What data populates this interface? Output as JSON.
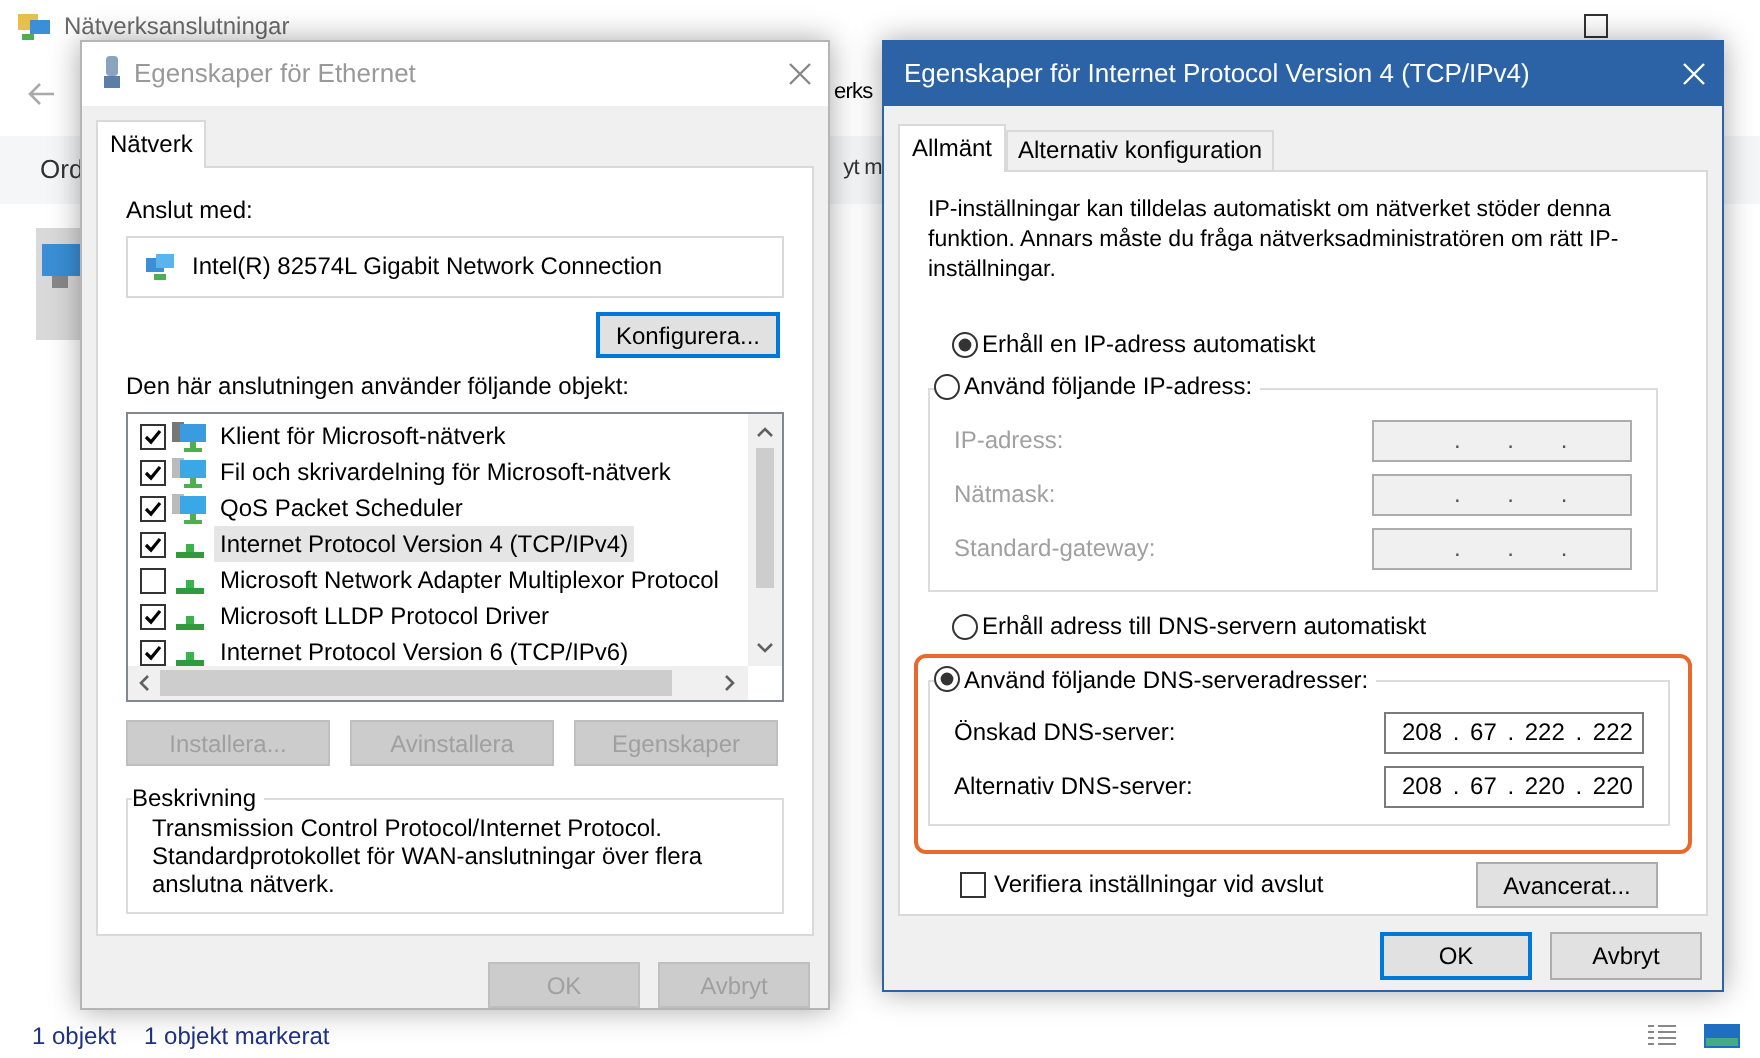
{
  "explorer": {
    "title": "Nätverksanslutningar",
    "address_fragment": "erks",
    "toolbar_left": "Ord",
    "toolbar_right": "yt m",
    "status_bar": [
      "1 objekt",
      "1 objekt markerat"
    ]
  },
  "ethernet_dialog": {
    "title": "Egenskaper för Ethernet",
    "active": false,
    "tabs": [
      {
        "label": "Nätverk",
        "selected": true
      }
    ],
    "connect_label": "Anslut med:",
    "adapter": "Intel(R) 82574L Gigabit Network Connection",
    "configure_button": "Konfigurera...",
    "items_label": "Den här anslutningen använder följande objekt:",
    "items": [
      {
        "label": "Klient för Microsoft-nätverk",
        "kind": "client",
        "checked": true,
        "selected": false
      },
      {
        "label": "Fil och skrivardelning för Microsoft-nätverk",
        "kind": "service",
        "checked": true,
        "selected": false
      },
      {
        "label": "QoS Packet Scheduler",
        "kind": "service",
        "checked": true,
        "selected": false
      },
      {
        "label": "Internet Protocol Version 4 (TCP/IPv4)",
        "kind": "protocol",
        "checked": true,
        "selected": true
      },
      {
        "label": "Microsoft Network Adapter Multiplexor Protocol",
        "kind": "protocol",
        "checked": false,
        "selected": false
      },
      {
        "label": "Microsoft LLDP Protocol Driver",
        "kind": "protocol",
        "checked": true,
        "selected": false
      },
      {
        "label": "Internet Protocol Version 6 (TCP/IPv6)",
        "kind": "protocol",
        "checked": true,
        "selected": false
      }
    ],
    "item_buttons": [
      {
        "label": "Installera...",
        "disabled": true
      },
      {
        "label": "Avinstallera",
        "disabled": true
      },
      {
        "label": "Egenskaper",
        "disabled": true
      }
    ],
    "description": {
      "title": "Beskrivning",
      "text": "Transmission Control Protocol/Internet Protocol. Standardprotokollet för WAN-anslutningar över flera anslutna nätverk."
    },
    "buttons": [
      {
        "label": "OK",
        "disabled": true
      },
      {
        "label": "Avbryt",
        "disabled": true
      }
    ]
  },
  "ipv4_dialog": {
    "title": "Egenskaper för Internet Protocol Version 4 (TCP/IPv4)",
    "active": true,
    "tabs": [
      {
        "label": "Allmänt",
        "selected": true
      },
      {
        "label": "Alternativ konfiguration",
        "selected": false
      }
    ],
    "intro": "IP-inställningar kan tilldelas automatiskt om nätverket stöder denna funktion. Annars måste du fråga nätverksadministratören om rätt IP-inställningar.",
    "ip_options": [
      {
        "label": "Erhåll en IP-adress automatiskt",
        "selected": true
      },
      {
        "label": "Använd följande IP-adress:",
        "selected": false
      }
    ],
    "ip_fields": [
      {
        "label": "IP-adress:",
        "value": ". . .",
        "disabled": true
      },
      {
        "label": "Nätmask:",
        "value": ". . .",
        "disabled": true
      },
      {
        "label": "Standard-gateway:",
        "value": ". . .",
        "disabled": true
      }
    ],
    "dns_options": [
      {
        "label": "Erhåll adress till DNS-servern automatiskt",
        "selected": false
      },
      {
        "label": "Använd följande DNS-serveradresser:",
        "selected": true
      }
    ],
    "dns_fields": [
      {
        "label": "Önskad DNS-server:",
        "value": "208 . 67 . 222 . 222",
        "disabled": false
      },
      {
        "label": "Alternativ DNS-server:",
        "value": "208 . 67 . 220 . 220",
        "disabled": false
      }
    ],
    "dns_highlighted": true,
    "verify": {
      "label": "Verifiera inställningar vid avslut",
      "checked": false
    },
    "advanced_button": "Avancerat...",
    "buttons": [
      {
        "label": "OK",
        "default": true
      },
      {
        "label": "Avbryt",
        "default": false
      }
    ]
  }
}
